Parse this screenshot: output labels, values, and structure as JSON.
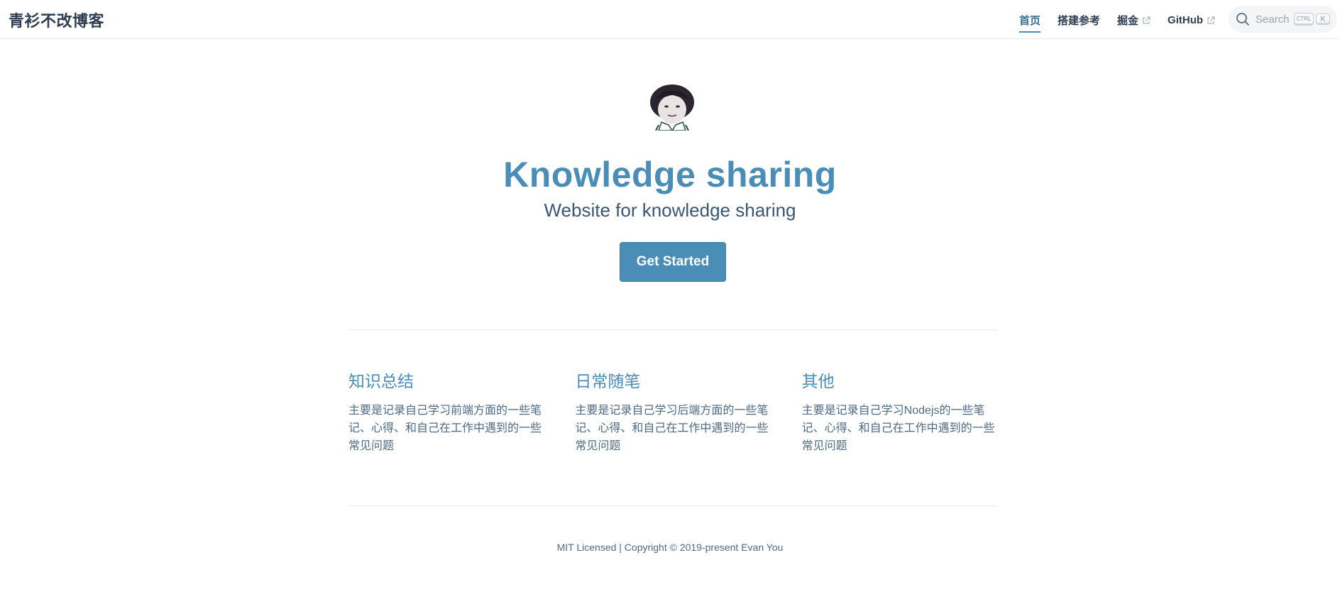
{
  "navbar": {
    "site_title": "青衫不改博客",
    "links": [
      {
        "label": "首页",
        "active": true,
        "external": false
      },
      {
        "label": "搭建参考",
        "active": false,
        "external": false
      },
      {
        "label": "掘金",
        "active": false,
        "external": true
      },
      {
        "label": "GitHub",
        "active": false,
        "external": true
      }
    ],
    "search": {
      "placeholder": "Search",
      "shortcut_ctrl": "CTRL",
      "shortcut_key": "K"
    }
  },
  "hero": {
    "title": "Knowledge sharing",
    "description": "Website for knowledge sharing",
    "cta_label": "Get Started"
  },
  "features": [
    {
      "title": "知识总结",
      "details": "主要是记录自己学习前端方面的一些笔记、心得、和自己在工作中遇到的一些常见问题"
    },
    {
      "title": "日常随笔",
      "details": "主要是记录自己学习后端方面的一些笔记、心得、和自己在工作中遇到的一些常见问题"
    },
    {
      "title": "其他",
      "details": "主要是记录自己学习Nodejs的一些笔记、心得、和自己在工作中遇到的一些常见问题"
    }
  ],
  "footer": {
    "text": "MIT Licensed | Copyright © 2019-present Evan You"
  },
  "colors": {
    "accent": "#4a8db7",
    "text": "#2c3e50"
  }
}
